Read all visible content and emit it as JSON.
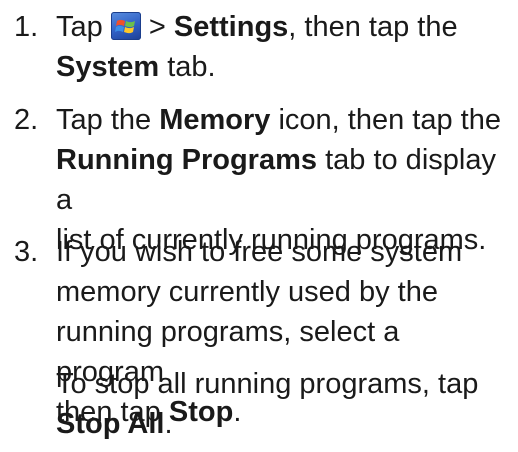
{
  "steps": [
    {
      "number": "1.",
      "line1_pre": "Tap ",
      "icon": "windows-start-icon",
      "line1_mid": " > ",
      "line1_bold": "Settings",
      "line1_post": ", then tap the",
      "line2_bold": "System",
      "line2_post": " tab."
    },
    {
      "number": "2.",
      "line1_pre": "Tap the ",
      "line1_bold": "Memory",
      "line1_post": " icon, then tap the",
      "line2_bold": "Running Programs",
      "line2_post": " tab to display a",
      "line3": "list of currently running programs."
    },
    {
      "number": "3.",
      "line1": "If you wish to free some system",
      "line2": "memory currently used by the",
      "line3": "running programs, select a program",
      "line4_pre": "then tap ",
      "line4_bold": "Stop",
      "line4_post": "."
    }
  ],
  "note": {
    "line1": "To stop all running programs, tap",
    "line2_bold": "Stop All",
    "line2_post": "."
  },
  "colors": {
    "text": "#1a1a1a",
    "icon_blue": "#2f5fc4"
  }
}
